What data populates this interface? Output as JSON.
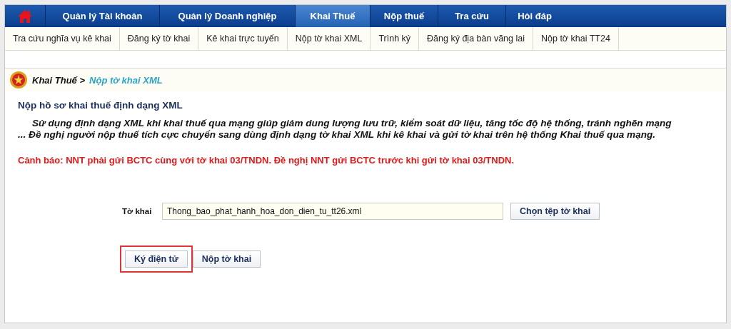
{
  "main_menu": [
    {
      "label": "Quản lý Tài khoản",
      "selected": false
    },
    {
      "label": "Quản lý Doanh nghiệp",
      "selected": false
    },
    {
      "label": "Khai Thuế",
      "selected": true
    },
    {
      "label": "Nộp thuế",
      "selected": false
    },
    {
      "label": "Tra cứu",
      "selected": false
    },
    {
      "label": "Hỏi đáp",
      "selected": false
    }
  ],
  "sub_menu": [
    "Tra cứu nghĩa vụ kê khai",
    "Đăng ký tờ khai",
    "Kê khai trực tuyến",
    "Nộp tờ khai XML",
    "Trình ký",
    "Đăng ký địa bàn vãng lai",
    "Nộp tờ khai TT24"
  ],
  "breadcrumb": {
    "parent": "Khai Thuế >",
    "current": "Nộp tờ khai XML"
  },
  "heading": "Nộp hồ sơ khai thuế định dạng XML",
  "intro": "Sử dụng định dạng XML khi khai thuế qua mạng giúp giảm dung lượng lưu trữ, kiểm soát dữ liệu, tăng tốc độ hệ thống, tránh nghẽn mạng ... Đề nghị người nộp thuế tích cực chuyển sang dùng định dạng tờ khai XML khi kê khai và gửi tờ khai trên hệ thống Khai thuế qua mạng.",
  "warning": "Cảnh báo: NNT phải gửi BCTC cùng với tờ khai 03/TNDN. Đề nghị NNT gửi BCTC trước khi gửi tờ khai 03/TNDN.",
  "file_field": {
    "label": "Tờ khai",
    "value": "Thong_bao_phat_hanh_hoa_don_dien_tu_tt26.xml",
    "button": "Chọn tệp tờ khai"
  },
  "actions": [
    {
      "label": "Ký điện tử",
      "highlighted": true
    },
    {
      "label": "Nộp tờ khai",
      "highlighted": false
    }
  ]
}
